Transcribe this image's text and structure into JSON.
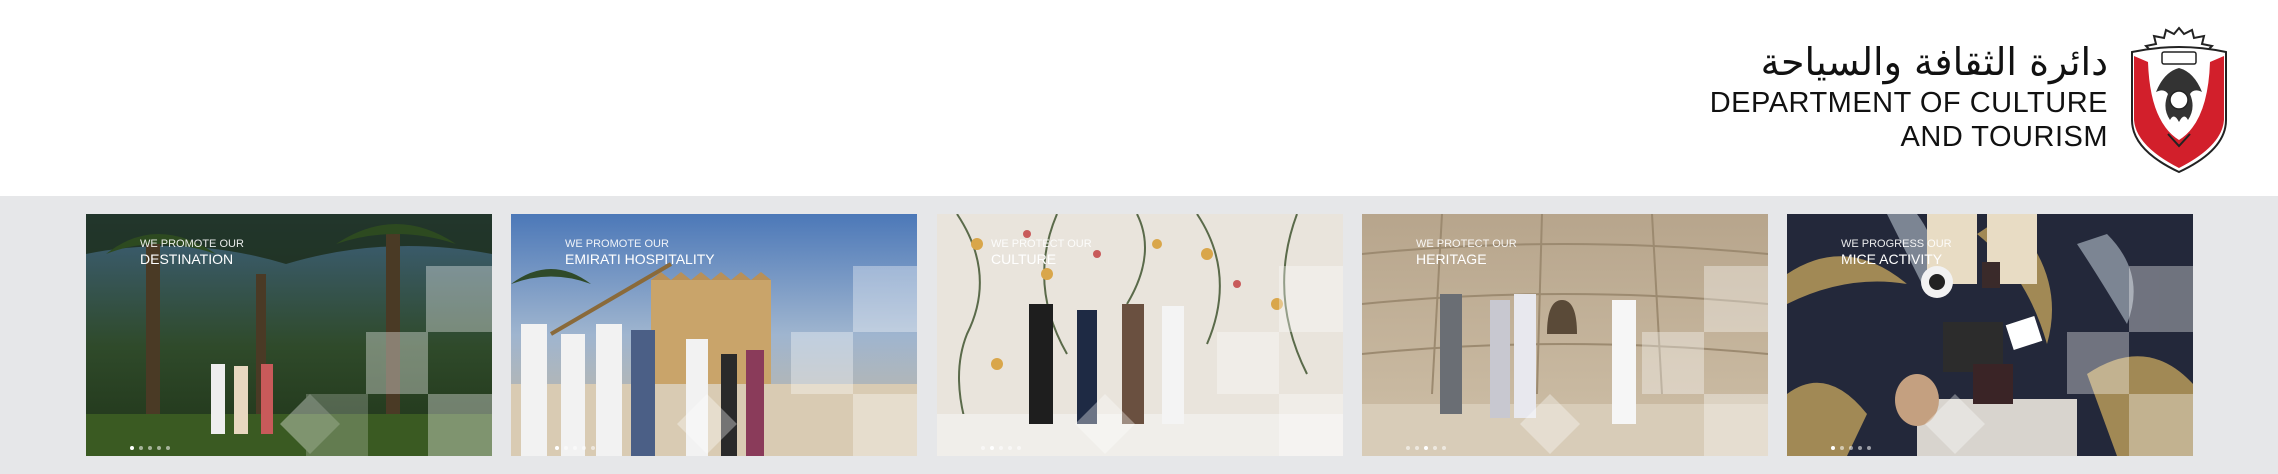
{
  "header": {
    "arabic_name": "دائرة الثقافة والسياحة",
    "english_line1": "DEPARTMENT OF CULTURE",
    "english_line2": "AND TOURISM"
  },
  "colors": {
    "band": "#e6e7e9",
    "emblem_red": "#d21f2b"
  },
  "cards": [
    {
      "pre": "WE PROMOTE OUR",
      "title": "DESTINATION",
      "theme": "palm-oasis",
      "active_dot": 1
    },
    {
      "pre": "WE PROMOTE OUR",
      "title": "EMIRATI HOSPITALITY",
      "theme": "fort-dance",
      "active_dot": 1
    },
    {
      "pre": "WE PROTECT OUR",
      "title": "CULTURE",
      "theme": "floral-wall",
      "active_dot": 2
    },
    {
      "pre": "WE PROTECT OUR",
      "title": "HERITAGE",
      "theme": "stone-tomb",
      "active_dot": 3
    },
    {
      "pre": "WE PROGRESS OUR",
      "title": "MICE ACTIVITY",
      "theme": "mosaic-meeting",
      "active_dot": 1
    }
  ]
}
